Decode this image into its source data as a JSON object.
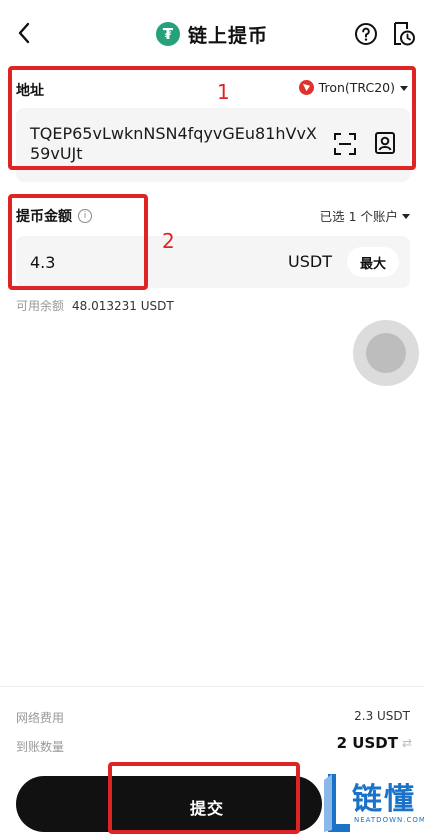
{
  "header": {
    "title": "链上提币"
  },
  "address": {
    "label": "地址",
    "network": "Tron(TRC20)",
    "value": "TQEP65vLwknNSN4fqyvGEu81hVvX59vUJt"
  },
  "amount": {
    "label": "提币金额",
    "account_selector": "已选 1 个账户",
    "value": "4.3",
    "unit": "USDT",
    "max_label": "最大",
    "available_label": "可用余额",
    "available_value": "48.013231 USDT"
  },
  "footer": {
    "fee_label": "网络费用",
    "fee_value": "2.3 USDT",
    "receive_label": "到账数量",
    "receive_value": "2 USDT",
    "submit_label": "提交"
  },
  "annotations": {
    "box1": "1",
    "box2": "2"
  },
  "watermark": {
    "brand": "链懂",
    "site": "NEATDOWN.COM"
  },
  "colors": {
    "tether": "#26a17b",
    "tron": "#e0322b",
    "annotation": "#e02424",
    "brand": "#1a73c8"
  },
  "icons": [
    "back-icon",
    "tether-icon",
    "help-icon",
    "history-icon",
    "tron-icon",
    "scan-icon",
    "address-book-icon",
    "info-icon",
    "chevron-down-icon",
    "swap-icon"
  ]
}
